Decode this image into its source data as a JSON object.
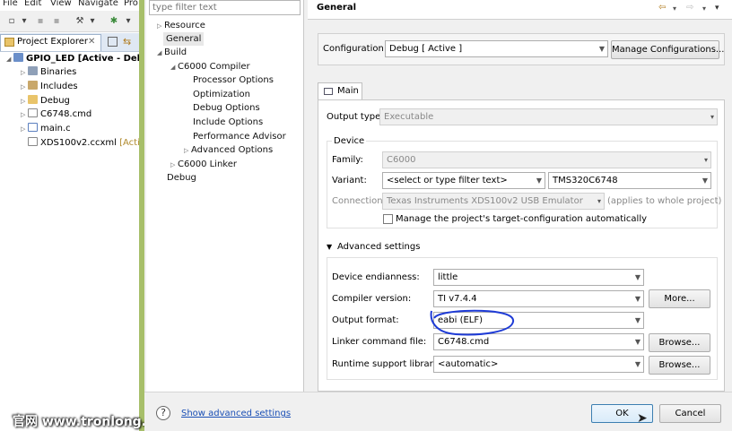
{
  "menubar": [
    "File",
    "Edit",
    "View",
    "Navigate",
    "Pro"
  ],
  "project_explorer": {
    "tab_label": "Project Explorer",
    "tab_close": "✕",
    "items": [
      {
        "label": "GPIO_LED  [Active - Debu",
        "bold": true
      },
      {
        "label": "Binaries"
      },
      {
        "label": "Includes"
      },
      {
        "label": "Debug"
      },
      {
        "label": "C6748.cmd"
      },
      {
        "label": "main.c"
      },
      {
        "label": "XDS100v2.ccxml",
        "suffix": "[Active"
      }
    ]
  },
  "watermark": "官网 www.tronlong.com",
  "nav": {
    "filter_placeholder": "type filter text",
    "items": [
      "Resource",
      "General",
      "Build",
      "C6000 Compiler",
      "Processor Options",
      "Optimization",
      "Debug Options",
      "Include Options",
      "Performance Advisor",
      "Advanced Options",
      "C6000 Linker",
      "Debug"
    ],
    "selected": "General"
  },
  "page": {
    "title": "General",
    "configuration_label": "Configuration:",
    "configuration_value": "Debug  [ Active ]",
    "manage_configurations": "Manage Configurations...",
    "main_tab": "Main",
    "output_type_label": "Output type:",
    "output_type_value": "Executable",
    "device_group": "Device",
    "family_label": "Family:",
    "family_value": "C6000",
    "variant_label": "Variant:",
    "variant_filter": "<select or type filter text>",
    "variant_value": "TMS320C6748",
    "connection_label": "Connection:",
    "connection_value": "Texas Instruments XDS100v2 USB Emulator",
    "connection_note": "(applies to whole project)",
    "manage_target_checkbox": "Manage the project's target-configuration automatically",
    "advanced_settings": "Advanced settings",
    "endianness_label": "Device endianness:",
    "endianness_value": "little",
    "compiler_label": "Compiler version:",
    "compiler_value": "TI v7.4.4",
    "more_button": "More...",
    "output_format_label": "Output format:",
    "output_format_value": "eabi (ELF)",
    "linker_label": "Linker command file:",
    "linker_value": "C6748.cmd",
    "browse_button": "Browse...",
    "runtime_label": "Runtime support library:",
    "runtime_value": "<automatic>",
    "browse_button_2": "Browse..."
  },
  "footer": {
    "help": "?",
    "show_advanced": "Show advanced settings",
    "ok": "OK",
    "cancel": "Cancel"
  },
  "colors": {
    "accent_green": "#a7bf6a",
    "link_blue": "#1a4fb5",
    "annotation_blue": "#1e3bd6"
  }
}
